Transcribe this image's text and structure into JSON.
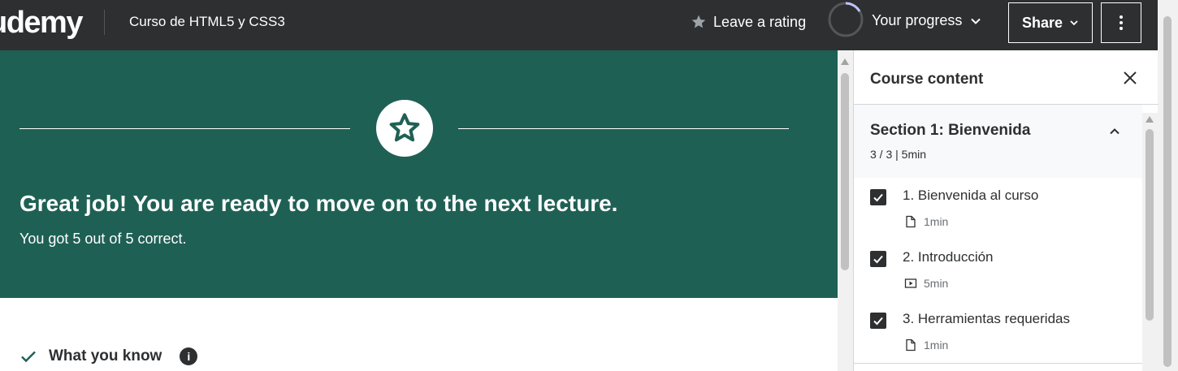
{
  "header": {
    "logo": "udemy",
    "course_title": "Curso de HTML5 y CSS3",
    "rating_label": "Leave a rating",
    "progress_label": "Your progress",
    "share_label": "Share"
  },
  "banner": {
    "headline": "Great job! You are ready to move on to the next lecture.",
    "result": "You got 5 out of 5 correct."
  },
  "main": {
    "what_you_know_label": "What you know",
    "info_glyph": "i"
  },
  "sidebar": {
    "title": "Course content",
    "section": {
      "title": "Section 1: Bienvenida",
      "meta": "3 / 3 | 5min",
      "lectures": [
        {
          "title": "1. Bienvenida al curso",
          "duration": "1min",
          "icon": "file-icon",
          "completed": true
        },
        {
          "title": "2. Introducción",
          "duration": "5min",
          "icon": "video-icon",
          "completed": true
        },
        {
          "title": "3. Herramientas requeridas",
          "duration": "1min",
          "icon": "file-icon",
          "completed": true
        }
      ]
    }
  },
  "colors": {
    "topbar": "#2d2f31",
    "banner": "#1f6055",
    "accent_purple": "#a435f0",
    "check_green": "#1e6055"
  }
}
